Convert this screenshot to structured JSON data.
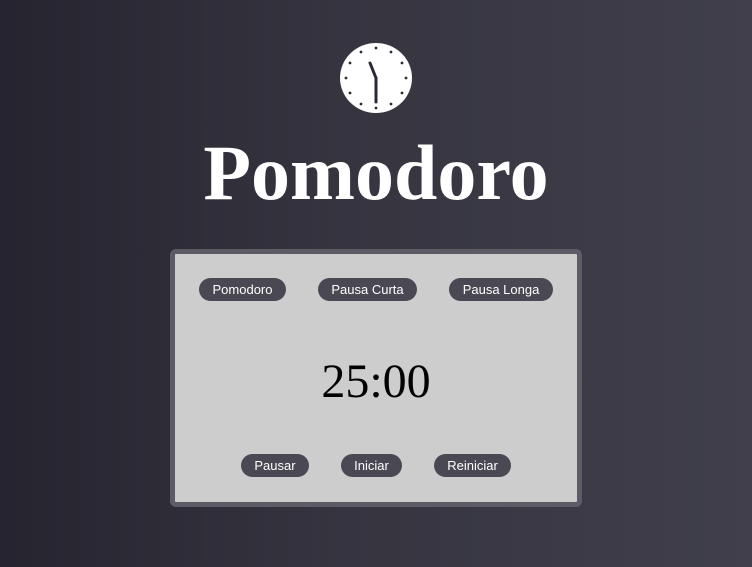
{
  "app": {
    "title": "Pomodoro",
    "logo_icon": "clock-icon"
  },
  "modes": [
    {
      "label": "Pomodoro"
    },
    {
      "label": "Pausa Curta"
    },
    {
      "label": "Pausa Longa"
    }
  ],
  "timer": {
    "display": "25:00"
  },
  "controls": {
    "pause_label": "Pausar",
    "start_label": "Iniciar",
    "reset_label": "Reiniciar"
  },
  "colors": {
    "background_dark": "#25242f",
    "background_light": "#403f4b",
    "card_bg": "#cdcdcd",
    "card_border": "#5d5c66",
    "button_bg": "#494853",
    "button_text": "#ffffff"
  }
}
